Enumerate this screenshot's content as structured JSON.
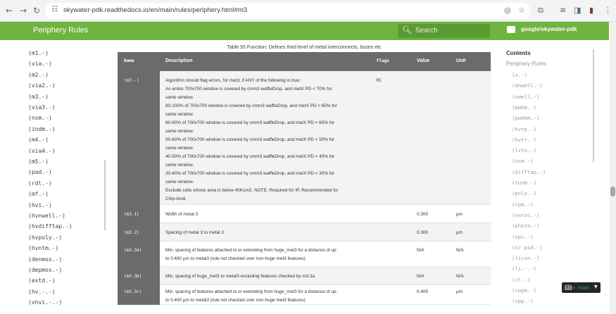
{
  "browser": {
    "url": "skywater-pdk.readthedocs.io/en/main/rules/periphery.html#m3",
    "back_glyph": "←",
    "forward_glyph": "→",
    "reload_glyph": "↻",
    "home_glyph": "⌂"
  },
  "header": {
    "brand": "Periphery Rules",
    "search_placeholder": "Search",
    "repo": "google/skywater-pdk",
    "color": "#6eb43f"
  },
  "leftnav": {
    "items": [
      "(m1.-)",
      "(via.-)",
      "(m2.-)",
      "(via2.-)",
      "(m3.-)",
      "(via3.-)",
      "(nsm.-)",
      "(indm.-)",
      "(m4.-)",
      "(via4.-)",
      "(m5.-)",
      "(pad.-)",
      "(rdl.-)",
      "(mf.-)",
      "(hvi.-)",
      "(hvnwell.-)",
      "(hvdifftap.-)",
      "(hvpoly.-)",
      "(hvntm.-)",
      "(denmos.-)",
      "(depmos.-)",
      "(extd.-)",
      "(hv.-.-)",
      "(vhvi.-.-)"
    ]
  },
  "table": {
    "caption": "Table 55 Function: Defines third level of metal interconnects, buses etc",
    "headers": {
      "name": "Name",
      "description": "Description",
      "flags": "Flags",
      "value": "Value",
      "unit": "Unit"
    },
    "rows": [
      {
        "name": "(m3.-)",
        "description": [
          "Algorithm should flag errors, for met3, if ANY of the following is true:",
          "An entire 700x700 window is covered by cmm3 waffleDrop, and metX PD < 70% for",
          "same window.",
          "80-100% of 700x700 window is covered by cmm3 waffleDrop, and metX PD < 65% for",
          "same window.",
          "60-80% of 700x700 window is covered by cmm3 waffleDrop, and metX PD < 60% for",
          "same window.",
          "50-60% of 700x700 window is covered by cmm3 waffleDrop, and metX PD < 50% for",
          "same window.",
          "40-50% of 700x700 window is covered by cmm3 waffleDrop, and metX PD < 40% for",
          "same window.",
          "30-40% of 700x700 window is covered by cmm3 waffleDrop, and metX PD < 30% for",
          "same window.",
          "Exclude cells whose area is below 40Kum2. NOTE: Required for IP, Recommended for",
          "Chip-level."
        ],
        "flags": "RC",
        "value": "",
        "unit": ""
      },
      {
        "name": "(m3.1)",
        "description": [
          "Width of metal 3"
        ],
        "flags": "",
        "value": "0.300",
        "unit": "µm"
      },
      {
        "name": "(m3.2)",
        "description": [
          "Spacing of metal 3 to metal 3"
        ],
        "flags": "",
        "value": "0.300",
        "unit": "µm"
      },
      {
        "name": "(m3.3a)",
        "description": [
          "Min. spacing of features attached to or extending from huge_met3 for a distance of up",
          "to 0.480 µm to metal3 (rule not checked over non-huge met3 features)"
        ],
        "flags": "",
        "value": "N/A",
        "unit": "N/A"
      },
      {
        "name": "(m3.3b)",
        "description": [
          "Min. spacing of huge_met3 to metal3 excluding features checked by m3.3a"
        ],
        "flags": "",
        "value": "N/A",
        "unit": "N/A"
      },
      {
        "name": "(m3.3c)",
        "description": [
          "Min. spacing of features attached to or extending from huge_met3 for a distance of up",
          "to 0.400 µm to metal3 (rule not checked over non-huge met3 features)"
        ],
        "flags": "",
        "value": "0.400",
        "unit": "µm"
      }
    ]
  },
  "toc": {
    "title": "Contents",
    "subtitle": "Periphery Rules",
    "items": [
      "(x.-)",
      "(dnwell.-)",
      "(nwell.-)",
      "(pwbm.-)",
      "(pwdem.-)",
      "(hvtp.-)",
      "(hvtr.-)",
      "(lvtn.-)",
      "(ncm.-)",
      "(difftap.-)",
      "(tunm.-)",
      "(poly.-)",
      "(rpm.-)",
      "(varac.-)",
      "(photo.-)",
      "(npc.-)",
      "(n/ psd.-)",
      "(licon.-)",
      "(li.-.-)",
      "(ct.-)",
      "(capm.-)",
      "(vpp.-)"
    ]
  },
  "version": {
    "label": "v: main"
  }
}
